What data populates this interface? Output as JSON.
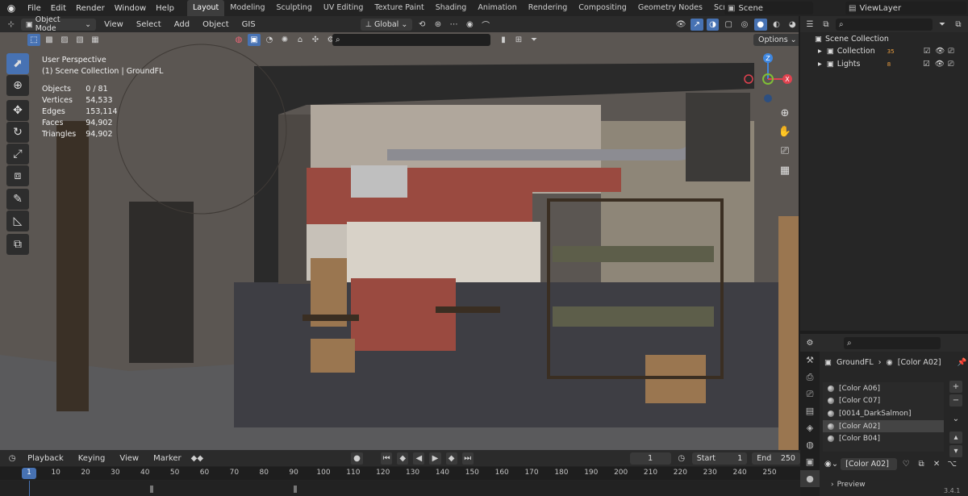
{
  "topbar": {
    "menus": [
      "File",
      "Edit",
      "Render",
      "Window",
      "Help"
    ],
    "workspaces": [
      "Layout",
      "Modeling",
      "Sculpting",
      "UV Editing",
      "Texture Paint",
      "Shading",
      "Animation",
      "Rendering",
      "Compositing",
      "Geometry Nodes",
      "Scripting",
      "+"
    ],
    "active_workspace": "Layout",
    "scene": "Scene",
    "view_layer": "ViewLayer"
  },
  "viewport": {
    "mode": "Object Mode",
    "menus": [
      "View",
      "Select",
      "Add",
      "Object",
      "GIS"
    ],
    "transform": "Global",
    "options": "Options",
    "perspective": "User Perspective",
    "collection_line": "(1) Scene Collection | GroundFL",
    "stats": [
      {
        "label": "Objects",
        "value": "0 / 81"
      },
      {
        "label": "Vertices",
        "value": "54,533"
      },
      {
        "label": "Edges",
        "value": "153,114"
      },
      {
        "label": "Faces",
        "value": "94,902"
      },
      {
        "label": "Triangles",
        "value": "94,902"
      }
    ],
    "gizmo": {
      "z": "Z",
      "x": "X"
    },
    "colors": {
      "accent": "#4772b3",
      "x_axis": "#e0424f",
      "y_axis": "#7fbf36",
      "z_axis": "#3f87e0"
    }
  },
  "outliner": {
    "root": "Scene Collection",
    "items": [
      {
        "name": "Collection",
        "badge": "35"
      },
      {
        "name": "Lights",
        "badge": "8"
      }
    ]
  },
  "properties": {
    "breadcrumb_object": "GroundFL",
    "breadcrumb_material": "[Color A02]",
    "materials": [
      "[Color A06]",
      "[Color C07]",
      "[0014_DarkSalmon]",
      "[Color A02]",
      "[Color B04]"
    ],
    "selected_index": 3,
    "material_field": "[Color A02]",
    "preview_label": "Preview"
  },
  "timeline": {
    "menus": [
      "Playback",
      "Keying",
      "View",
      "Marker"
    ],
    "current_frame": "1",
    "start_label": "Start",
    "start": "1",
    "end_label": "End",
    "end": "250",
    "ticks": [
      "1",
      "10",
      "20",
      "30",
      "40",
      "50",
      "60",
      "70",
      "80",
      "90",
      "100",
      "110",
      "120",
      "130",
      "140",
      "150",
      "160",
      "170",
      "180",
      "190",
      "200",
      "210",
      "220",
      "230",
      "240",
      "250"
    ]
  },
  "status": {
    "version": "3.4.1"
  }
}
